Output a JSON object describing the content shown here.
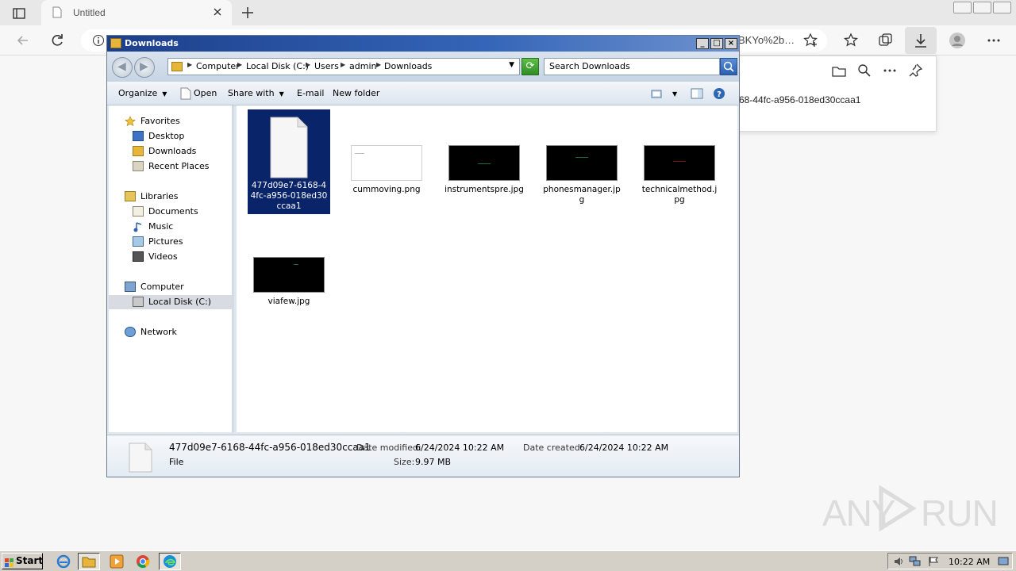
{
  "browser": {
    "tab_title": "Untitled",
    "address_fragment": "BKYo%2b…",
    "downloads_flyout": {
      "file_name_fragment": "68-44fc-a956-018ed30ccaa1"
    }
  },
  "explorer": {
    "title": "Downloads",
    "breadcrumb": [
      "Computer",
      "Local Disk (C:)",
      "Users",
      "admin",
      "Downloads"
    ],
    "search_placeholder": "Search Downloads",
    "commands": {
      "organize": "Organize",
      "open": "Open",
      "share_with": "Share with",
      "email": "E-mail",
      "new_folder": "New folder"
    },
    "nav": {
      "favorites": "Favorites",
      "desktop": "Desktop",
      "downloads": "Downloads",
      "recent_places": "Recent Places",
      "libraries": "Libraries",
      "documents": "Documents",
      "music": "Music",
      "pictures": "Pictures",
      "videos": "Videos",
      "computer": "Computer",
      "local_disk": "Local Disk (C:)",
      "network": "Network"
    },
    "files": [
      {
        "name": "477d09e7-6168-44fc-a956-018ed30ccaa1",
        "selected": true
      },
      {
        "name": "cummoving.png"
      },
      {
        "name": "instrumentspre.jpg"
      },
      {
        "name": "phonesmanager.jpg"
      },
      {
        "name": "technicalmethod.jpg"
      },
      {
        "name": "viafew.jpg"
      }
    ],
    "details": {
      "file_name": "477d09e7-6168-44fc-a956-018ed30ccaa1",
      "file_type": "File",
      "date_modified_label": "Date modified:",
      "date_modified": "6/24/2024 10:22 AM",
      "date_created_label": "Date created:",
      "date_created": "6/24/2024 10:22 AM",
      "size_label": "Size:",
      "size": "9.97 MB"
    }
  },
  "taskbar": {
    "start_label": "Start",
    "clock": "10:22 AM"
  },
  "watermark": {
    "left": "ANY",
    "right": "RUN"
  },
  "colors": {
    "selection": "#0a246a",
    "title_bar": "#1c3f8a",
    "thumb_green": "#1a6b3a",
    "thumb_red": "#6b1a1a"
  }
}
